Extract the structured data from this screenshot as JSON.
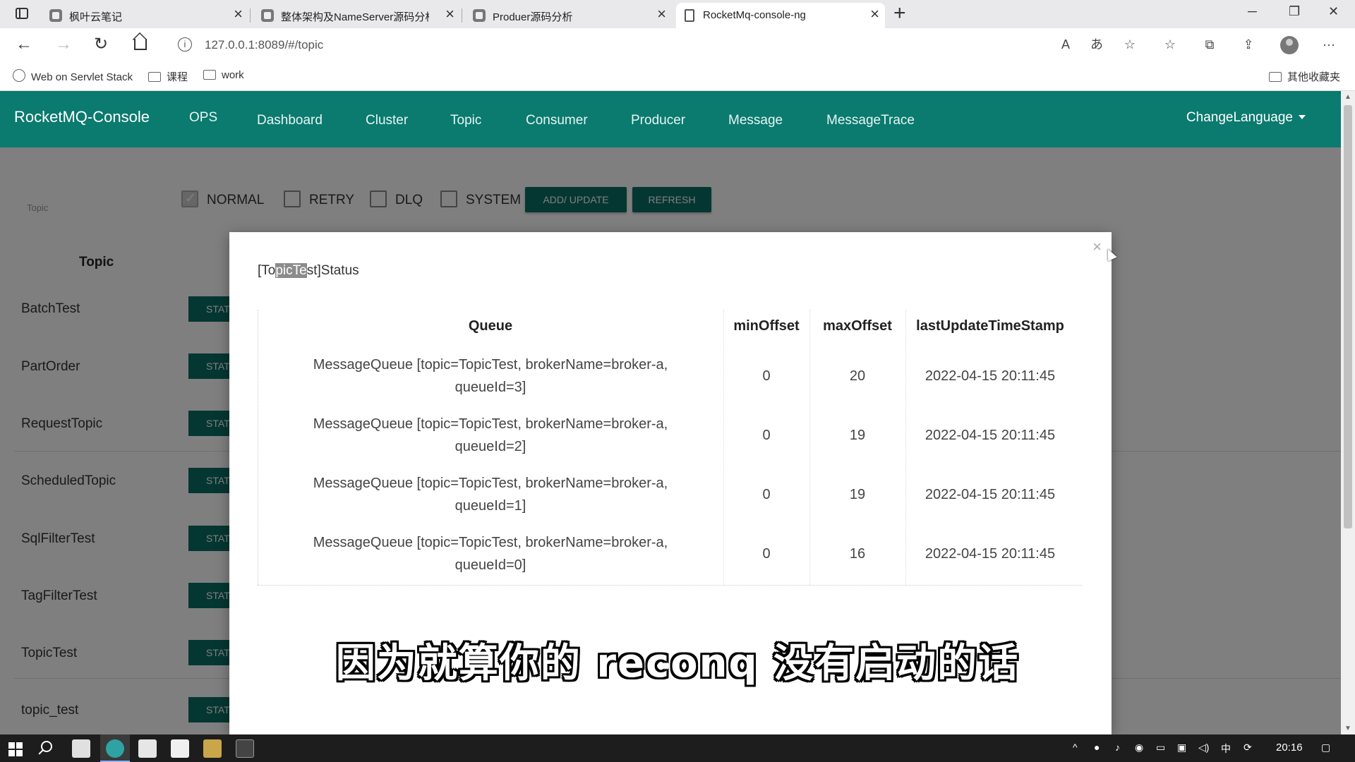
{
  "browser": {
    "tabs": [
      {
        "title": "枫叶云笔记"
      },
      {
        "title": "整体架构及NameServer源码分析"
      },
      {
        "title": "Produer源码分析"
      },
      {
        "title": "RocketMq-console-ng"
      }
    ],
    "url": "127.0.0.1:8089/#/topic",
    "bookmarks": [
      {
        "label": "Web on Servlet Stack"
      },
      {
        "label": "课程"
      },
      {
        "label": "work"
      }
    ],
    "other_bookmarks": "其他收藏夹"
  },
  "app": {
    "brand": "RocketMQ-Console",
    "nav": [
      "OPS",
      "Dashboard",
      "Cluster",
      "Topic",
      "Consumer",
      "Producer",
      "Message",
      "MessageTrace"
    ],
    "change_language": "ChangeLanguage",
    "topic_crumb": "Topic",
    "filters": [
      {
        "label": "NORMAL",
        "checked": true
      },
      {
        "label": "RETRY",
        "checked": false
      },
      {
        "label": "DLQ",
        "checked": false
      },
      {
        "label": "SYSTEM",
        "checked": false
      }
    ],
    "add_update_label": "ADD/ UPDATE",
    "refresh_label": "REFRESH",
    "list_header": "Topic",
    "topics": [
      {
        "name": "BatchTest",
        "action": "STATUS"
      },
      {
        "name": "PartOrder",
        "action": "STATUS"
      },
      {
        "name": "RequestTopic",
        "action": "STATUS"
      },
      {
        "name": "ScheduledTopic",
        "action": "STATUS"
      },
      {
        "name": "SqlFilterTest",
        "action": "STATUS"
      },
      {
        "name": "TagFilterTest",
        "action": "STATUS"
      },
      {
        "name": "TopicTest",
        "action": "STATUS"
      },
      {
        "name": "topic_test",
        "action": "STATUS"
      }
    ]
  },
  "modal": {
    "title_prefix": "[To",
    "title_highlight": "picTe",
    "title_suffix": "st]Status",
    "close": "×",
    "columns": [
      "Queue",
      "minOffset",
      "maxOffset",
      "lastUpdateTimeStamp"
    ],
    "rows": [
      {
        "queue_line1": "MessageQueue [topic=TopicTest, brokerName=broker-a,",
        "queue_line2": "queueId=3]",
        "min": "0",
        "max": "20",
        "ts": "2022-04-15 20:11:45"
      },
      {
        "queue_line1": "MessageQueue [topic=TopicTest, brokerName=broker-a,",
        "queue_line2": "queueId=2]",
        "min": "0",
        "max": "19",
        "ts": "2022-04-15 20:11:45"
      },
      {
        "queue_line1": "MessageQueue [topic=TopicTest, brokerName=broker-a,",
        "queue_line2": "queueId=1]",
        "min": "0",
        "max": "19",
        "ts": "2022-04-15 20:11:45"
      },
      {
        "queue_line1": "MessageQueue [topic=TopicTest, brokerName=broker-a,",
        "queue_line2": "queueId=0]",
        "min": "0",
        "max": "16",
        "ts": "2022-04-15 20:11:45"
      }
    ]
  },
  "subtitle": "因为就算你的 reconq 没有启动的话",
  "taskbar": {
    "time": "20:16",
    "ime": "中"
  },
  "colors": {
    "navbar": "#0b7a6f",
    "button": "#0b6e64",
    "overlay": "rgba(0,0,0,0.5)"
  }
}
